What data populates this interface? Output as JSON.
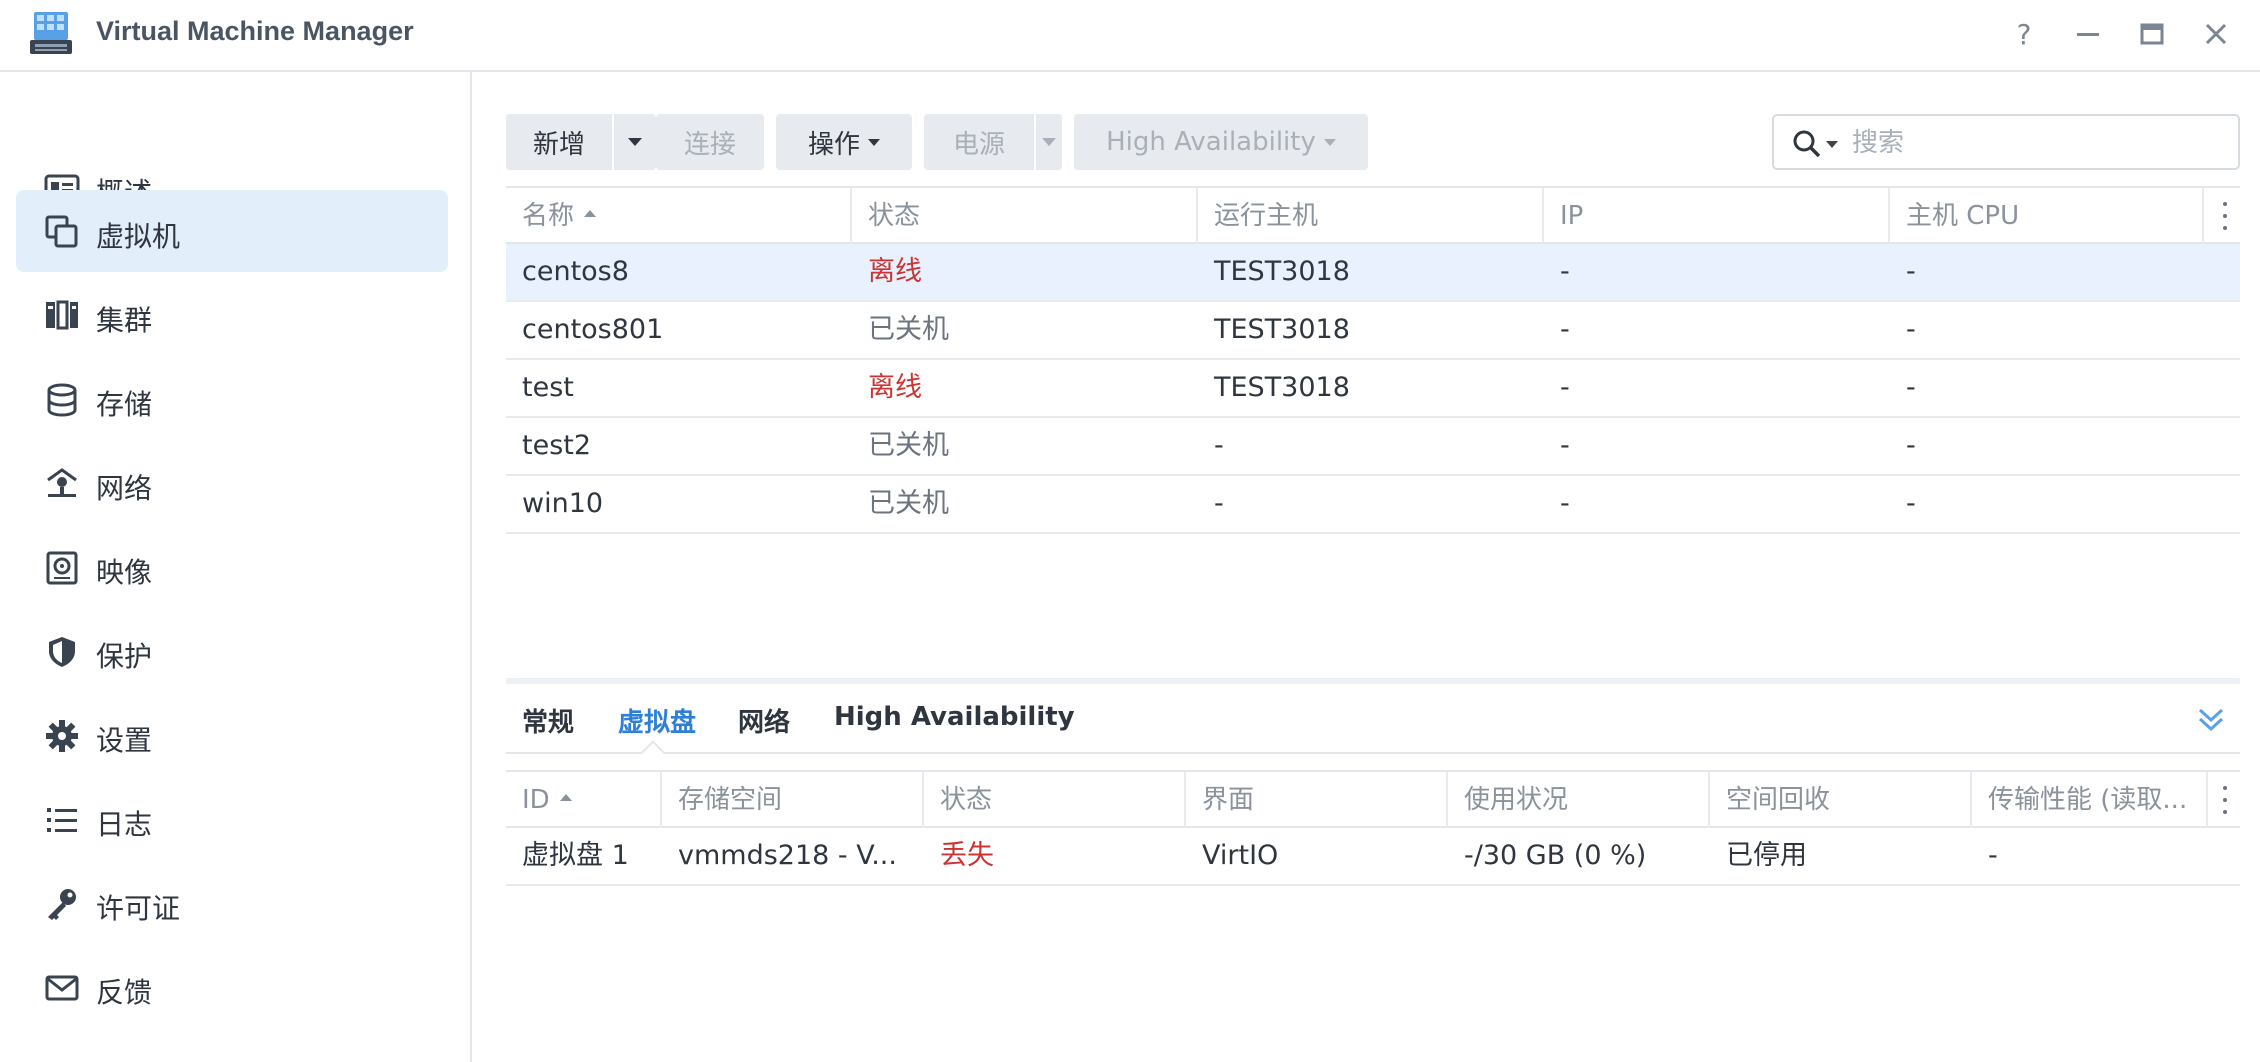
{
  "window": {
    "title": "Virtual Machine Manager",
    "help": "?",
    "minimize": "—",
    "maximize": "▭",
    "close": "✕"
  },
  "sidebar": {
    "items": [
      {
        "label": "概述",
        "icon": "overview-icon"
      },
      {
        "label": "虚拟机",
        "icon": "virtual-machine-icon",
        "active": true
      },
      {
        "label": "集群",
        "icon": "cluster-icon"
      },
      {
        "label": "存储",
        "icon": "storage-icon"
      },
      {
        "label": "网络",
        "icon": "network-icon"
      },
      {
        "label": "映像",
        "icon": "image-icon"
      },
      {
        "label": "保护",
        "icon": "shield-icon"
      },
      {
        "label": "设置",
        "icon": "gear-icon"
      },
      {
        "label": "日志",
        "icon": "list-icon"
      },
      {
        "label": "许可证",
        "icon": "key-icon"
      },
      {
        "label": "反馈",
        "icon": "mail-icon"
      }
    ]
  },
  "toolbar": {
    "add": "新增",
    "connect": "连接",
    "action": "操作",
    "power": "电源",
    "ha": "High Availability",
    "search_placeholder": "搜索"
  },
  "vm_table": {
    "columns": [
      "名称",
      "状态",
      "运行主机",
      "IP",
      "主机 CPU"
    ],
    "rows": [
      {
        "name": "centos8",
        "status": "离线",
        "host": "TEST3018",
        "ip": "-",
        "cpu": "-",
        "selected": true,
        "status_color": "#cc3333"
      },
      {
        "name": "centos801",
        "status": "已关机",
        "host": "TEST3018",
        "ip": "-",
        "cpu": "-"
      },
      {
        "name": "test",
        "status": "离线",
        "host": "TEST3018",
        "ip": "-",
        "cpu": "-",
        "status_color": "#cc3333"
      },
      {
        "name": "test2",
        "status": "已关机",
        "host": "-",
        "ip": "-",
        "cpu": "-"
      },
      {
        "name": "win10",
        "status": "已关机",
        "host": "-",
        "ip": "-",
        "cpu": "-"
      }
    ]
  },
  "detail_tabs": {
    "items": [
      "常规",
      "虚拟盘",
      "网络",
      "High Availability"
    ],
    "active": "虚拟盘"
  },
  "disk_table": {
    "columns": [
      "ID",
      "存储空间",
      "状态",
      "界面",
      "使用状况",
      "空间回收",
      "传输性能 (读取..."
    ],
    "rows": [
      {
        "id": "虚拟盘 1",
        "storage": "vmmds218 - V...",
        "status": "丢失",
        "interface": "VirtIO",
        "usage": "-/30 GB (0 %)",
        "reclaim": "已停用",
        "perf": "-"
      }
    ]
  },
  "colors": {
    "accent": "#2d7fd8",
    "selected_row": "#e8f1fd",
    "sidebar_active": "#e3eefb",
    "error_text": "#cc3333"
  }
}
